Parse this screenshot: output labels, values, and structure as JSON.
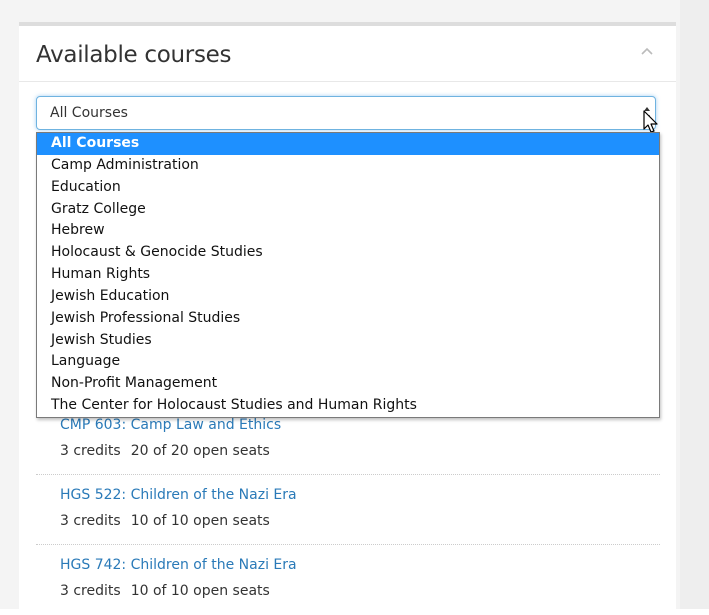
{
  "panel": {
    "title": "Available courses"
  },
  "filter": {
    "selected": "All Courses",
    "options": [
      "All Courses",
      "Camp Administration",
      "Education",
      "Gratz College",
      "Hebrew",
      "Holocaust & Genocide Studies",
      "Human Rights",
      "Jewish Education",
      "Jewish Professional Studies",
      "Jewish Studies",
      "Language",
      "Non-Profit Management",
      "The Center for Holocaust Studies and Human Rights"
    ]
  },
  "courses": [
    {
      "title": "CMP 603: Camp Law and Ethics",
      "credits": "3 credits",
      "seats": "20 of 20 open seats"
    },
    {
      "title": "HGS 522: Children of the Nazi Era",
      "credits": "3 credits",
      "seats": "10 of 10 open seats"
    },
    {
      "title": "HGS 742: Children of the Nazi Era",
      "credits": "3 credits",
      "seats": "10 of 10 open seats"
    }
  ],
  "colors": {
    "accent": "#1e90ff",
    "link": "#2a7ab8",
    "focus_border": "#6fb3e0"
  }
}
